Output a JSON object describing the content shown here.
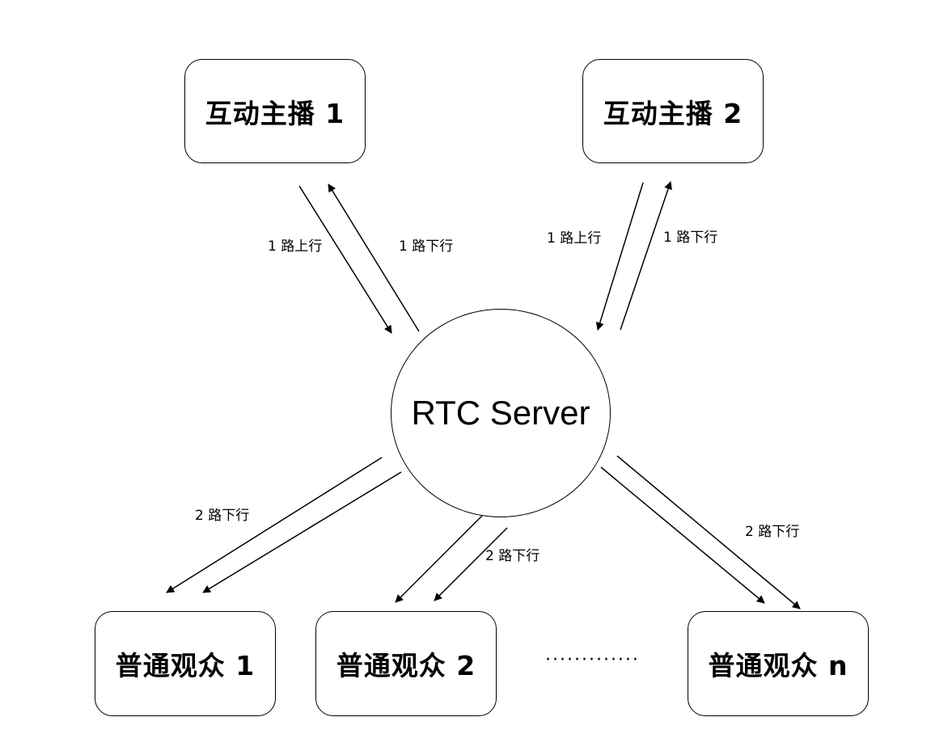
{
  "server": {
    "label": "RTC Server"
  },
  "hosts": [
    {
      "label": "互动主播 1",
      "up_label": "1 路上行",
      "down_label": "1 路下行"
    },
    {
      "label": "互动主播 2",
      "up_label": "1 路上行",
      "down_label": "1 路下行"
    }
  ],
  "viewers": [
    {
      "label": "普通观众 1",
      "down_label": "2 路下行"
    },
    {
      "label": "普通观众 2",
      "down_label": "2 路下行"
    },
    {
      "label": "普通观众 n",
      "down_label": "2 路下行"
    }
  ],
  "ellipsis": "·············",
  "colors": {
    "stroke": "#000000",
    "background": "#ffffff"
  }
}
